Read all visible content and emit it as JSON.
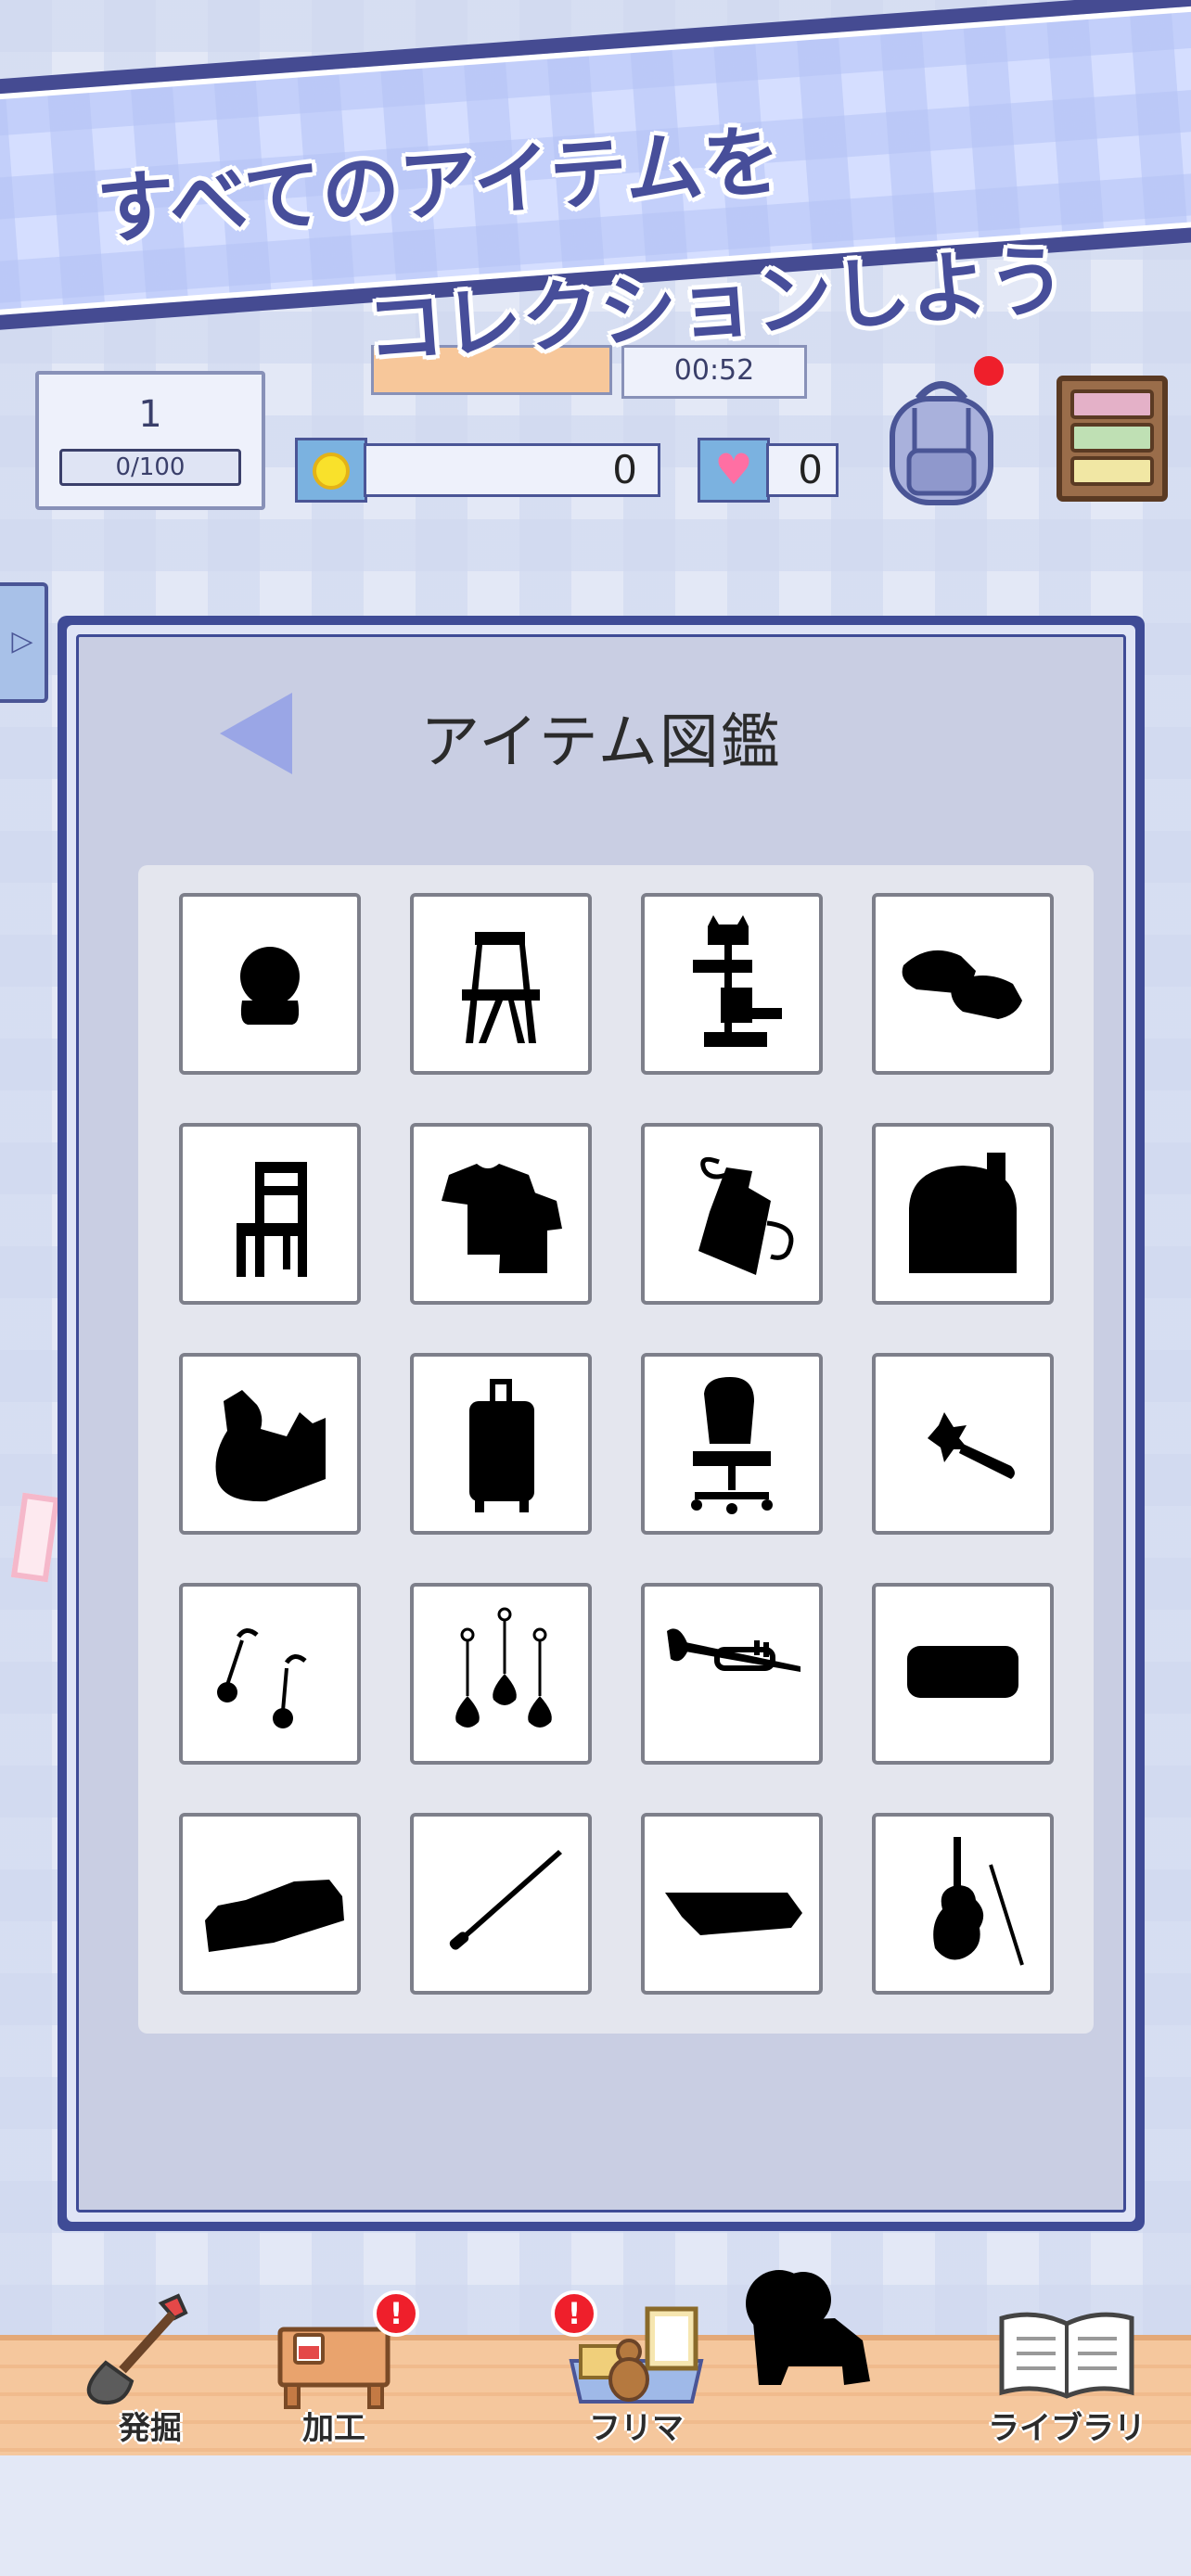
{
  "banner": {
    "line1": "すべてのアイテムを",
    "line2": "コレクションしよう"
  },
  "status": {
    "level": "1",
    "progress": "0/100",
    "timer": "00:52",
    "coins": "0",
    "hearts": "0"
  },
  "panel": {
    "title": "アイテム図鑑"
  },
  "items": [
    {
      "icon": "snow-globe-icon"
    },
    {
      "icon": "folding-chair-icon"
    },
    {
      "icon": "cat-tower-icon"
    },
    {
      "icon": "slippers-icon"
    },
    {
      "icon": "wooden-chair-icon"
    },
    {
      "icon": "t-shirts-icon"
    },
    {
      "icon": "apron-icon"
    },
    {
      "icon": "mailbox-icon"
    },
    {
      "icon": "bags-icon"
    },
    {
      "icon": "suitcase-icon"
    },
    {
      "icon": "office-chair-icon"
    },
    {
      "icon": "hair-clip-icon"
    },
    {
      "icon": "ball-earrings-icon"
    },
    {
      "icon": "drop-earrings-icon"
    },
    {
      "icon": "trumpet-icon"
    },
    {
      "icon": "cushion-icon"
    },
    {
      "icon": "sofa-icon"
    },
    {
      "icon": "baton-icon"
    },
    {
      "icon": "xylophone-icon"
    },
    {
      "icon": "violin-icon"
    }
  ],
  "nav": {
    "dig": "発掘",
    "craft": "加工",
    "flea": "フリマ",
    "library": "ライブラリ"
  },
  "colors": {
    "panel_border": "#3f4b96",
    "banner_text": "#474e9a",
    "alert": "#ef1f2b"
  }
}
